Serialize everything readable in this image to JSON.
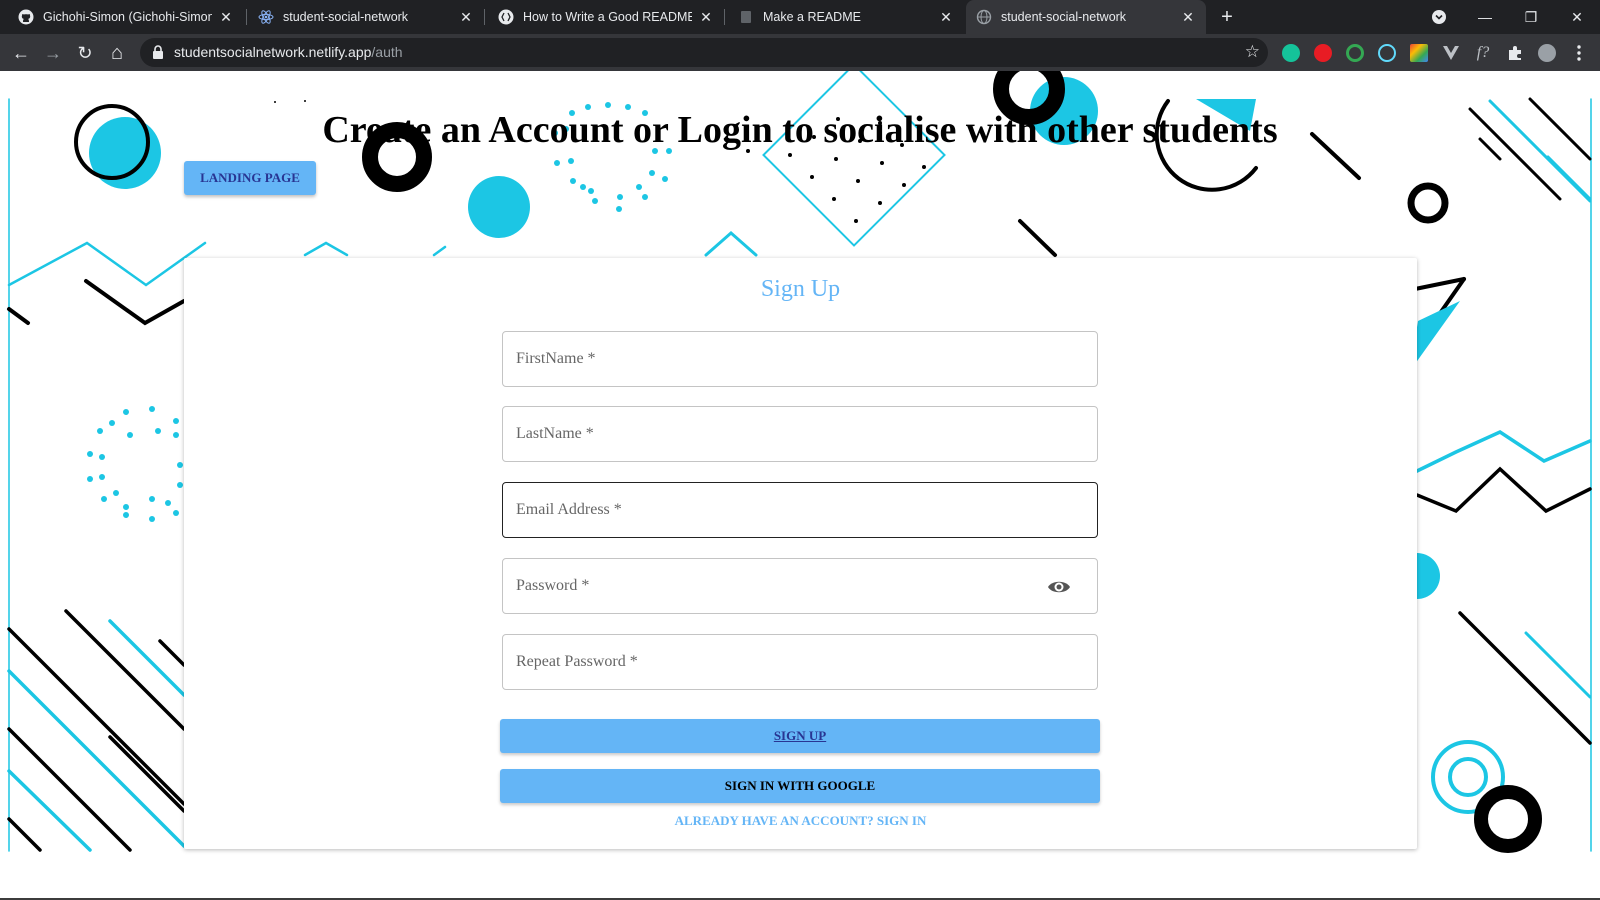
{
  "browser": {
    "tabs": [
      {
        "title": "Gichohi-Simon (Gichohi-Simon)",
        "icon": "github-icon"
      },
      {
        "title": "student-social-network",
        "icon": "react-icon"
      },
      {
        "title": "How to Write a Good README Fi",
        "icon": "dev-icon"
      },
      {
        "title": "Make a README",
        "icon": "document-icon"
      },
      {
        "title": "student-social-network",
        "icon": "globe-icon",
        "active": true
      }
    ],
    "new_tab_label": "+",
    "url_host": "studentsocialnetwork.netlify.app",
    "url_path": "/auth",
    "window_controls": {
      "minimize": "—",
      "restore": "❐",
      "close": "✕"
    },
    "nav": {
      "back": "←",
      "forward": "→",
      "reload": "↻",
      "home": "⌂"
    },
    "star": "☆",
    "extensions": [
      "grammarly-icon",
      "adblock-icon",
      "target-icon",
      "react-devtools-icon",
      "color-icon",
      "vue-icon",
      "formula-icon",
      "puzzle-icon",
      "profile-icon",
      "menu-icon"
    ]
  },
  "hero": {
    "title": "Create an Account or Login to socialise with other students",
    "landing_button": "LANDING PAGE"
  },
  "form": {
    "title": "Sign Up",
    "fields": {
      "first_name": "FirstName *",
      "last_name": "LastName *",
      "email": "Email Address *",
      "password": "Password *",
      "repeat_password": "Repeat Password *"
    },
    "signup_button": "SIGN UP",
    "google_button": "SIGN IN WITH GOOGLE",
    "signin_link": "ALREADY HAVE AN ACCOUNT? SIGN IN"
  },
  "colors": {
    "accent": "#64b5f6",
    "cyan": "#1cc6e4",
    "button_text": "#283593"
  }
}
